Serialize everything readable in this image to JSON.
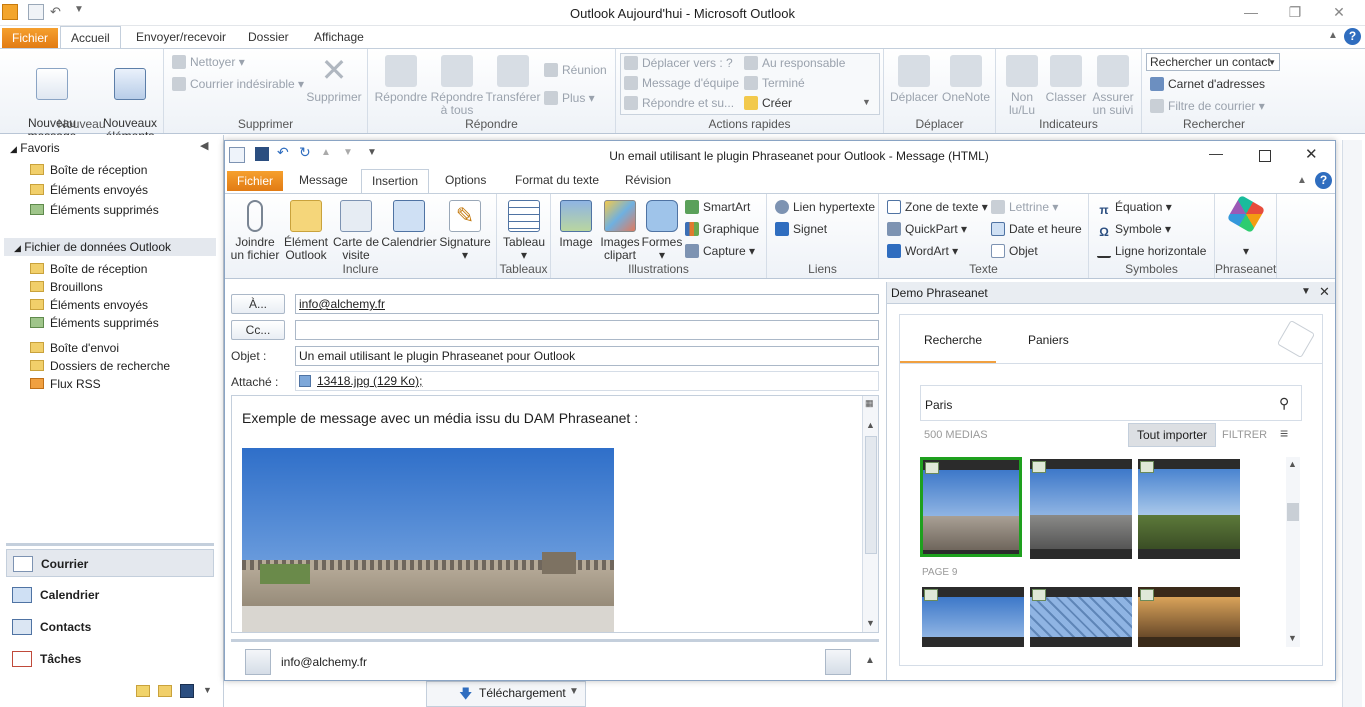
{
  "outer": {
    "title": "Outlook Aujourd'hui  -  Microsoft Outlook",
    "tabs": [
      "Fichier",
      "Accueil",
      "Envoyer/recevoir",
      "Dossier",
      "Affichage"
    ],
    "ribbon": {
      "nouveau": {
        "label": "Nouveau",
        "new_message": "Nouveau message\nélectronique",
        "new_items": "Nouveaux\néléments"
      },
      "supprimer": {
        "label": "Supprimer",
        "nettoyer": "Nettoyer",
        "indesirable": "Courrier indésirable",
        "supprimer": "Supprimer"
      },
      "repondre": {
        "label": "Répondre",
        "repondre": "Répondre",
        "repondre_tous": "Répondre\nà tous",
        "transferer": "Transférer",
        "reunion": "Réunion",
        "plus": "Plus"
      },
      "actions_rapides": {
        "label": "Actions rapides",
        "items": [
          "Déplacer vers : ?",
          "Au responsable",
          "Message d'équipe",
          "Terminé",
          "Répondre et su...",
          "Créer"
        ]
      },
      "deplacer": {
        "label": "Déplacer",
        "deplacer": "Déplacer",
        "onenote": "OneNote"
      },
      "indicateurs": {
        "label": "Indicateurs",
        "non_lu": "Non\nlu/Lu",
        "classer": "Classer",
        "assurer": "Assurer\nun suivi"
      },
      "rechercher": {
        "label": "Rechercher",
        "contact_placeholder": "Rechercher un contact",
        "carnet": "Carnet d'adresses",
        "filtre": "Filtre de courrier"
      }
    }
  },
  "nav": {
    "favoris": "Favoris",
    "favoris_items": [
      "Boîte de réception",
      "Éléments envoyés",
      "Éléments supprimés"
    ],
    "data_file": "Fichier de données Outlook",
    "data_items": [
      "Boîte de réception",
      "Brouillons",
      "Éléments envoyés",
      "Éléments supprimés",
      "Boîte d'envoi",
      "Dossiers de recherche",
      "Flux RSS"
    ],
    "modules": [
      "Courrier",
      "Calendrier",
      "Contacts",
      "Tâches"
    ],
    "status_bottom": "Téléchargement"
  },
  "message": {
    "title": "Un email utilisant le plugin Phraseanet pour Outlook  -  Message (HTML)",
    "tabs": [
      "Fichier",
      "Message",
      "Insertion",
      "Options",
      "Format du texte",
      "Révision"
    ],
    "ribbon": {
      "inclure": {
        "label": "Inclure",
        "joindre": "Joindre\nun fichier",
        "element": "Élément\nOutlook",
        "carte": "Carte de\nvisite",
        "calendrier": "Calendrier",
        "signature": "Signature"
      },
      "tableaux": {
        "label": "Tableaux",
        "tableau": "Tableau"
      },
      "illustrations": {
        "label": "Illustrations",
        "image": "Image",
        "images_clipart": "Images\nclipart",
        "formes": "Formes",
        "smartart": "SmartArt",
        "graphique": "Graphique",
        "capture": "Capture"
      },
      "liens": {
        "label": "Liens",
        "lien": "Lien hypertexte",
        "signet": "Signet"
      },
      "texte": {
        "label": "Texte",
        "zone": "Zone de texte",
        "quickpart": "QuickPart",
        "wordart": "WordArt",
        "lettrine": "Lettrine",
        "date": "Date et heure",
        "objet": "Objet"
      },
      "symboles": {
        "label": "Symboles",
        "equation": "Équation",
        "symbole": "Symbole",
        "ligne": "Ligne horizontale"
      },
      "phraseanet": {
        "label": "Phraseanet"
      }
    },
    "to_label": "À...",
    "cc_label": "Cc...",
    "subject_label": "Objet :",
    "attach_label": "Attaché :",
    "to_value": "info@alchemy.fr",
    "subject_value": "Un email utilisant le plugin Phraseanet pour Outlook",
    "attachment": "13418.jpg (129 Ko);",
    "body_text": "Exemple de message avec un média issu du DAM Phraseanet :",
    "people_email": "info@alchemy.fr"
  },
  "panel": {
    "title": "Demo Phraseanet",
    "tabs": [
      "Recherche",
      "Paniers"
    ],
    "search_value": "Paris",
    "count": "500 MEDIAS",
    "import_all": "Tout importer",
    "filter": "FILTRER",
    "page_label": "PAGE 9"
  }
}
